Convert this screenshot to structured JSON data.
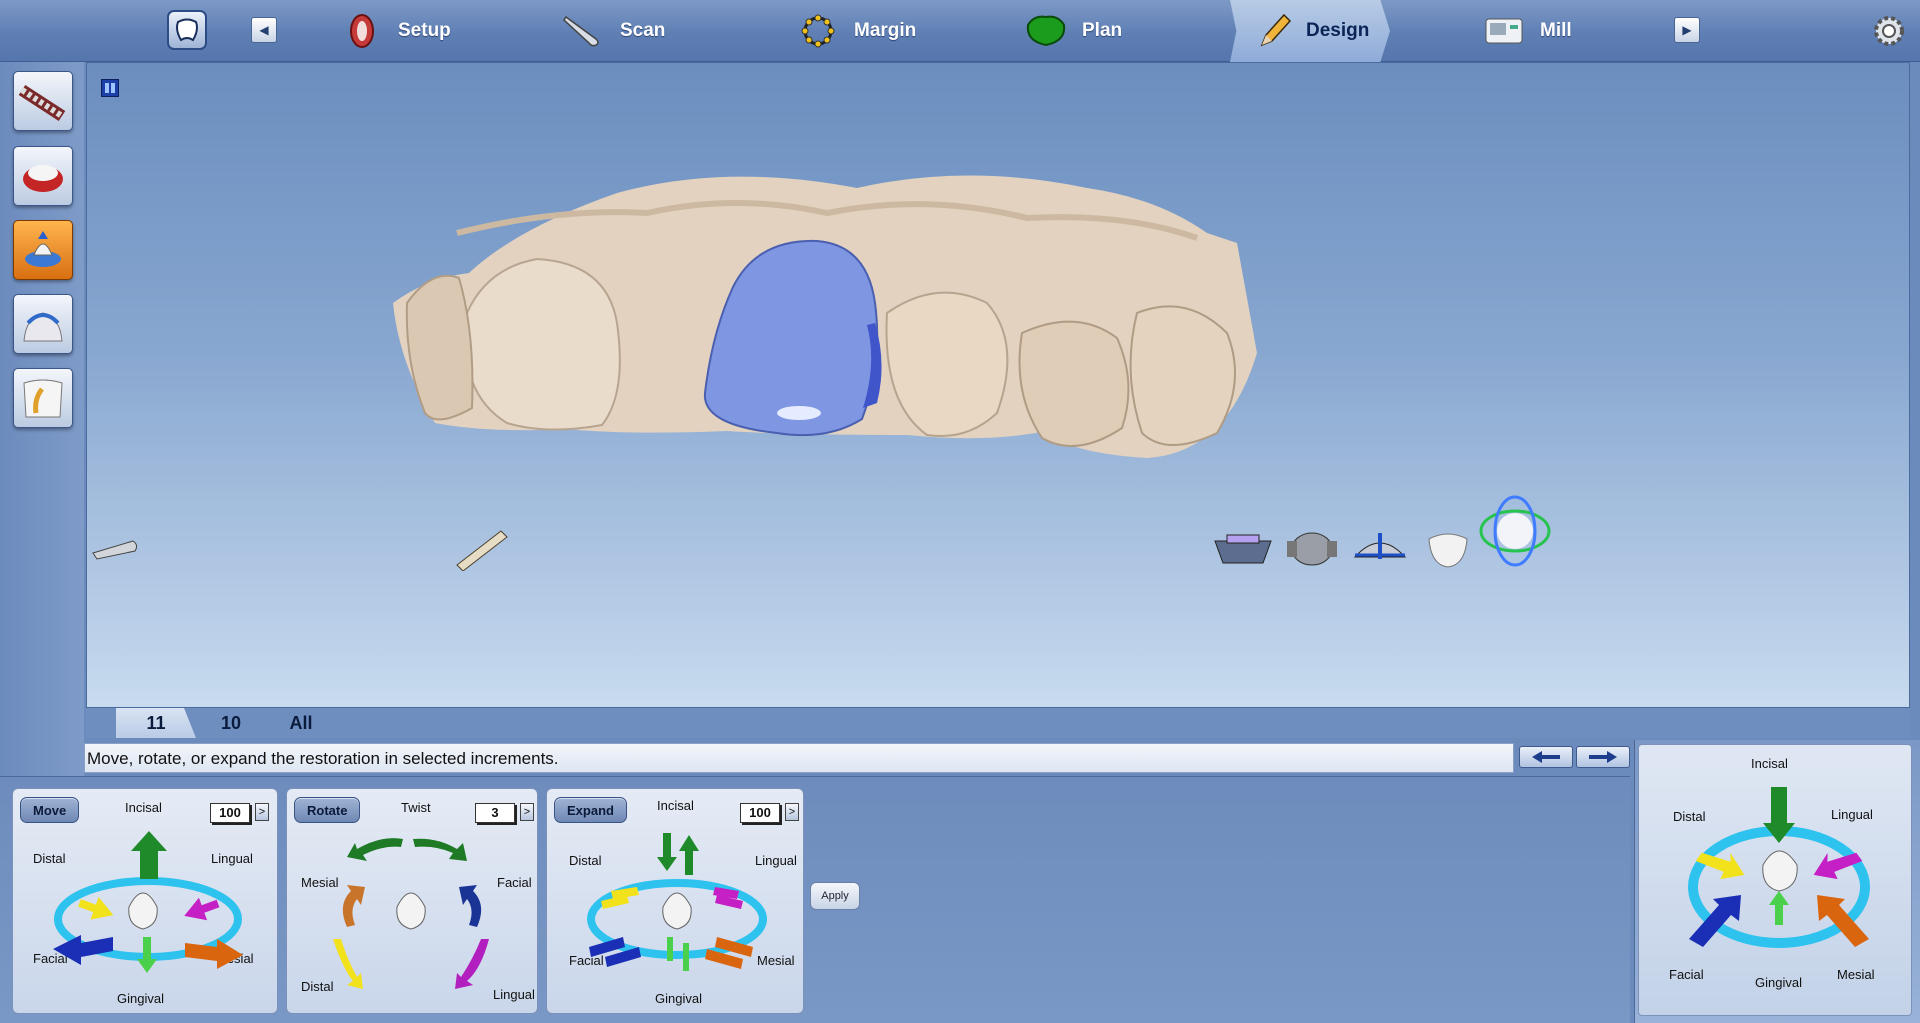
{
  "topbar": {
    "steps": [
      {
        "label": "Setup"
      },
      {
        "label": "Scan"
      },
      {
        "label": "Margin"
      },
      {
        "label": "Plan"
      },
      {
        "label": "Design"
      },
      {
        "label": "Mill"
      }
    ],
    "active_step": "Design"
  },
  "tooth_tabs": [
    "11",
    "10",
    "All"
  ],
  "active_tooth": "11",
  "status_text": "Move, rotate, or expand the restoration in selected increments.",
  "move": {
    "button": "Move",
    "value": "100",
    "labels": {
      "top": "Incisal",
      "left": "Distal",
      "right": "Lingual",
      "bottom_left": "Facial",
      "bottom_right": "Mesial",
      "bottom": "Gingival"
    }
  },
  "rotate": {
    "button": "Rotate",
    "value": "3",
    "labels": {
      "top": "Twist",
      "left": "Mesial",
      "right": "Facial",
      "bottom_left": "Distal",
      "bottom_right": "Lingual"
    }
  },
  "expand": {
    "button": "Expand",
    "value": "100",
    "labels": {
      "top": "Incisal",
      "left": "Distal",
      "right": "Lingual",
      "bottom_left": "Facial",
      "bottom_right": "Mesial",
      "bottom": "Gingival"
    }
  },
  "apply_label": "Apply",
  "orientation": {
    "labels": {
      "top": "Incisal",
      "left": "Distal",
      "right": "Lingual",
      "bottom_left": "Facial",
      "bottom_right": "Mesial",
      "bottom": "Gingival"
    }
  },
  "colors": {
    "restoration": "#7f96e3",
    "model": "#e2d2bf",
    "arrow_green": "#1e8a2a",
    "arrow_yellow": "#f2e21c",
    "arrow_magenta": "#c51fc6",
    "arrow_blue": "#1a2fb5",
    "arrow_orange": "#d9650f",
    "ring_cyan": "#2ec3ef"
  }
}
